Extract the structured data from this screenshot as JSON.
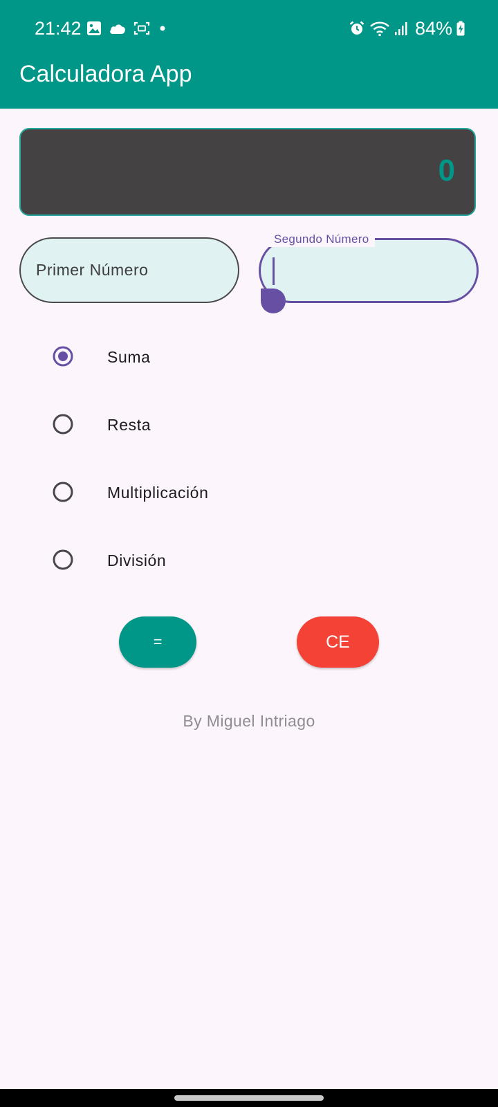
{
  "status_bar": {
    "time": "21:42",
    "left_icons": [
      "gallery-icon",
      "cloud-icon",
      "screen-capture-icon",
      "notification-dot-icon"
    ],
    "right_icons": [
      "alarm-icon",
      "wifi-icon",
      "signal-icon"
    ],
    "battery": "84%",
    "charging": true
  },
  "app_bar": {
    "title": "Calculadora App",
    "color": "#009688"
  },
  "display": {
    "value": "0",
    "value_color": "#009688"
  },
  "inputs": {
    "first": {
      "placeholder": "Primer Número",
      "value": ""
    },
    "second": {
      "label": "Segundo Número",
      "value": "",
      "focused": true,
      "accent": "#6750a4"
    }
  },
  "operations": {
    "selected": "Suma",
    "options": [
      {
        "label": "Suma",
        "selected": true
      },
      {
        "label": "Resta",
        "selected": false
      },
      {
        "label": "Multiplicación",
        "selected": false
      },
      {
        "label": "División",
        "selected": false
      }
    ]
  },
  "buttons": {
    "equals": {
      "label": "=",
      "color": "#009688"
    },
    "clear": {
      "label": "CE",
      "color": "#f44336"
    }
  },
  "footer": {
    "text": "By Miguel Intriago"
  }
}
